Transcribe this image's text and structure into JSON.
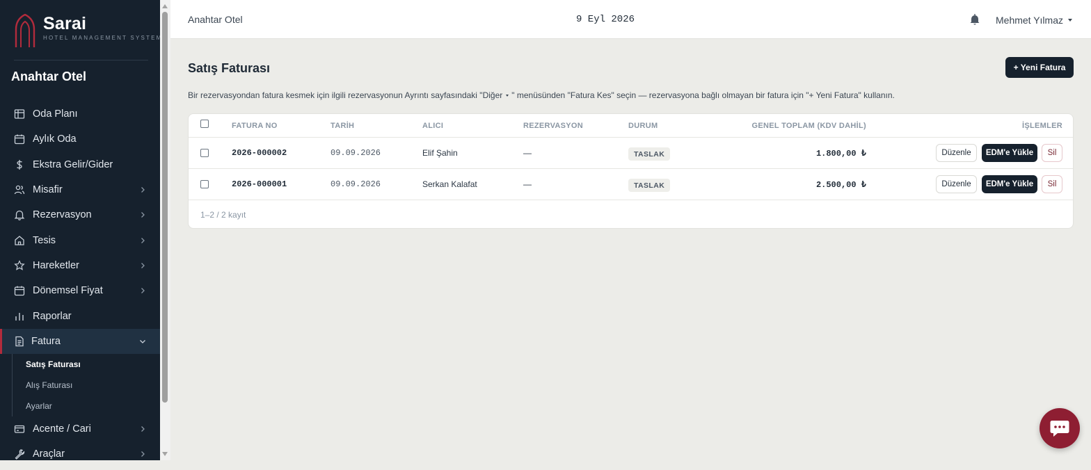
{
  "brand": {
    "name": "Sarai",
    "subtitle": "HOTEL MANAGEMENT SYSTEM",
    "accent": "#b22b3c"
  },
  "sidebar": {
    "hotel": "Anahtar Otel",
    "items": [
      {
        "label": "Oda Planı",
        "icon": "grid-icon",
        "has_children": false
      },
      {
        "label": "Aylık Oda",
        "icon": "calendar-icon",
        "has_children": false
      },
      {
        "label": "Ekstra Gelir/Gider",
        "icon": "dollar-icon",
        "has_children": false
      },
      {
        "label": "Misafir",
        "icon": "users-icon",
        "has_children": true
      },
      {
        "label": "Rezervasyon",
        "icon": "bell-icon",
        "has_children": true
      },
      {
        "label": "Tesis",
        "icon": "home-icon",
        "has_children": true
      },
      {
        "label": "Hareketler",
        "icon": "star-icon",
        "has_children": true
      },
      {
        "label": "Dönemsel Fiyat",
        "icon": "calendar-icon",
        "has_children": true
      },
      {
        "label": "Raporlar",
        "icon": "bar-chart-icon",
        "has_children": false
      },
      {
        "label": "Fatura",
        "icon": "document-icon",
        "has_children": true,
        "expanded": true,
        "active": true
      },
      {
        "label": "Acente / Cari",
        "icon": "credit-card-icon",
        "has_children": true
      },
      {
        "label": "Araçlar",
        "icon": "wrench-icon",
        "has_children": true
      }
    ],
    "fatura_sub": [
      {
        "label": "Satış Faturası",
        "active": true
      },
      {
        "label": "Alış Faturası",
        "active": false
      },
      {
        "label": "Ayarlar",
        "active": false
      }
    ]
  },
  "topbar": {
    "hotel": "Anahtar Otel",
    "date": "9 Eyl 2026",
    "user": "Mehmet Yılmaz"
  },
  "page": {
    "title": "Satış Faturası",
    "new_button": "+ Yeni Fatura",
    "hint_before": "Bir rezervasyondan fatura kesmek için ilgili rezervasyonun Ayrıntı sayfasındaki \"Diğer",
    "hint_after": "\" menüsünden \"Fatura Kes\" seçin — rezervasyona bağlı olmayan bir fatura için \"+ Yeni Fatura\" kullanın."
  },
  "table": {
    "columns": {
      "invoice_no": "FATURA NO",
      "date": "TARİH",
      "recipient": "ALICI",
      "reservation": "REZERVASYON",
      "status": "DURUM",
      "total": "GENEL TOPLAM (KDV DAHİL)",
      "actions": "İŞLEMLER"
    },
    "rows": [
      {
        "invoice_no": "2026-000002",
        "date": "09.09.2026",
        "recipient": "Elif Şahin",
        "reservation": "—",
        "status": "TASLAK",
        "total": "1.800,00 ₺"
      },
      {
        "invoice_no": "2026-000001",
        "date": "09.09.2026",
        "recipient": "Serkan Kalafat",
        "reservation": "—",
        "status": "TASLAK",
        "total": "2.500,00 ₺"
      }
    ],
    "actions": {
      "edit": "Düzenle",
      "upload": "EDM'e Yükle",
      "delete": "Sil"
    },
    "count": "1–2 / 2 kayıt"
  },
  "colors": {
    "sidebar_bg": "#16212d",
    "page_bg": "#ecece8",
    "fab": "#8e1e32"
  }
}
